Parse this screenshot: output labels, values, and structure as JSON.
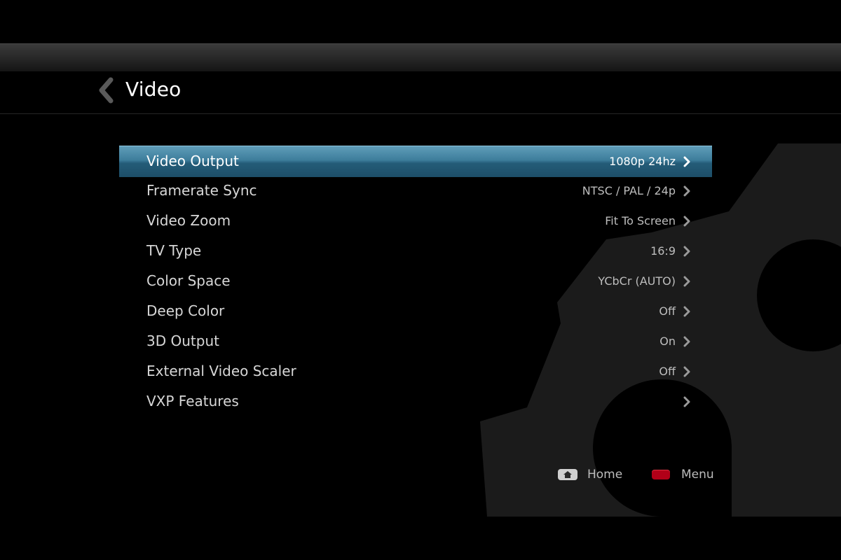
{
  "header": {
    "title": "Video"
  },
  "menu": {
    "items": [
      {
        "label": "Video Output",
        "value": "1080p 24hz",
        "selected": true
      },
      {
        "label": "Framerate Sync",
        "value": "NTSC / PAL / 24p"
      },
      {
        "label": "Video Zoom",
        "value": "Fit To Screen"
      },
      {
        "label": "TV Type",
        "value": "16:9"
      },
      {
        "label": "Color Space",
        "value": "YCbCr (AUTO)"
      },
      {
        "label": "Deep Color",
        "value": "Off"
      },
      {
        "label": "3D Output",
        "value": "On"
      },
      {
        "label": "External Video Scaler",
        "value": "Off"
      },
      {
        "label": "VXP Features",
        "value": ""
      }
    ]
  },
  "footer": {
    "home_label": "Home",
    "menu_label": "Menu"
  },
  "colors": {
    "selection": "#3d7d9b",
    "menu_key": "#b10018",
    "gear": "#1b1b1b"
  },
  "icons": {
    "back": "chevron-left-icon",
    "item_arrow": "chevron-right-icon",
    "home": "home-icon",
    "menu": "red-key-icon",
    "background": "gear-icon"
  }
}
